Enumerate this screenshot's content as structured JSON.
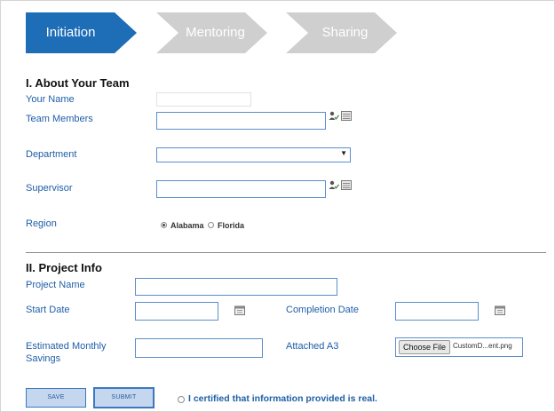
{
  "wizard": {
    "steps": [
      {
        "label": "Initiation",
        "active": true
      },
      {
        "label": "Mentoring",
        "active": false
      },
      {
        "label": "Sharing",
        "active": false
      }
    ]
  },
  "section1": {
    "title": "I. About Your Team",
    "your_name_label": "Your Name",
    "team_members_label": "Team Members",
    "department_label": "Department",
    "supervisor_label": "Supervisor",
    "region_label": "Region",
    "region_options": [
      {
        "label": "Alabama",
        "checked": true
      },
      {
        "label": "Florida",
        "checked": false
      }
    ]
  },
  "section2": {
    "title": "II. Project Info",
    "project_name_label": "Project Name",
    "start_date_label": "Start Date",
    "completion_date_label": "Completion Date",
    "estimated_savings_label_line1": "Estimated Monthly",
    "estimated_savings_label_line2": "Savings",
    "attached_label": "Attached A3",
    "choose_file_label": "Choose File",
    "file_name": "CustomD...ent.png"
  },
  "footer": {
    "save_label": "SAVE",
    "submit_label": "SUBMIT",
    "certify_label": "I certified that information provided is real."
  },
  "colors": {
    "accent": "#1d6db7",
    "label": "#1f5ea8",
    "inactive_step": "#cfcfcf"
  }
}
